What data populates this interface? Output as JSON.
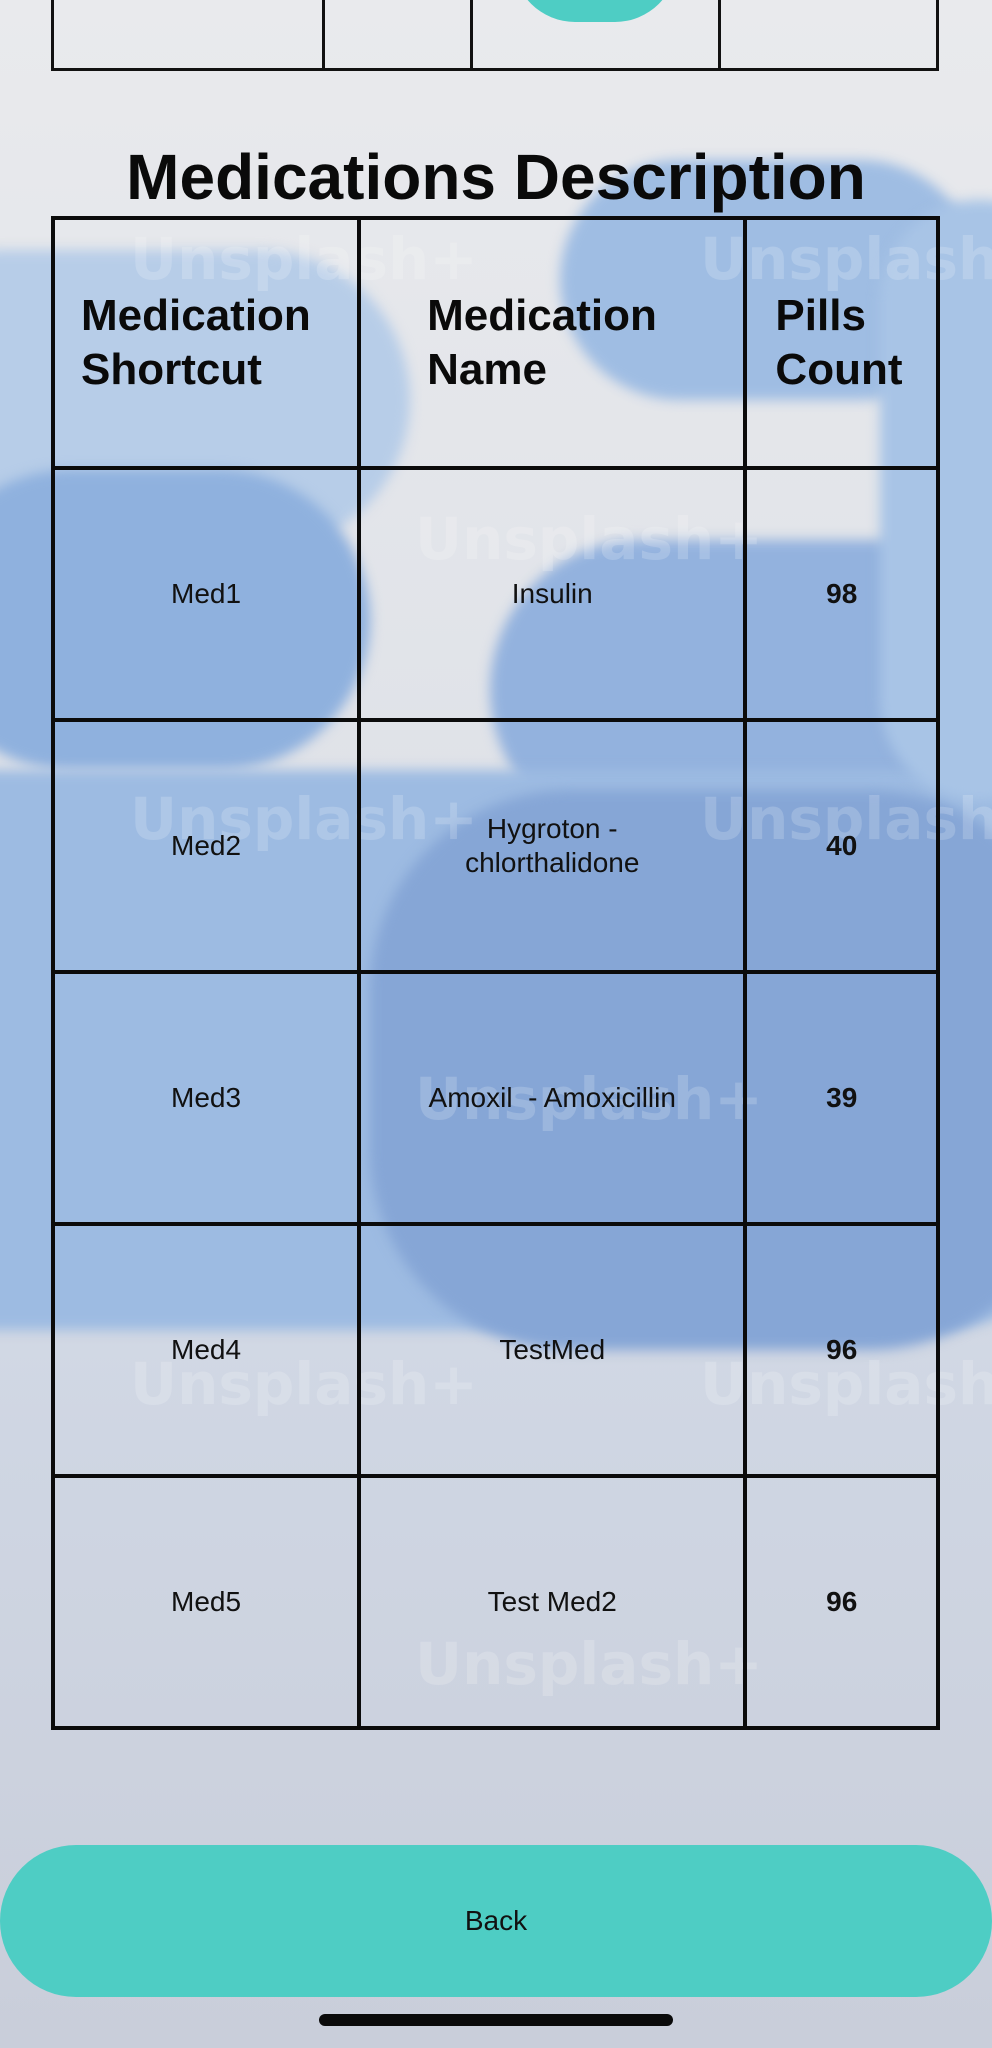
{
  "page": {
    "title": "Medications Description",
    "accent_color": "#4ECDC4",
    "count_color": "#E8161B",
    "background_image": "blue-pills-photo",
    "watermark_text": "Unsplash+"
  },
  "table": {
    "headers": {
      "shortcut": "Medication Shortcut",
      "name": "Medication Name",
      "count": "Pills Count"
    },
    "rows": [
      {
        "shortcut": "Med1",
        "name": "Insulin",
        "count": "98"
      },
      {
        "shortcut": "Med2",
        "name": "Hygroton - chlorthalidone",
        "count": "40"
      },
      {
        "shortcut": "Med3",
        "name": "Amoxil  - Amoxicillin",
        "count": "39"
      },
      {
        "shortcut": "Med4",
        "name": "TestMed",
        "count": "96"
      },
      {
        "shortcut": "Med5",
        "name": "Test Med2",
        "count": "96"
      }
    ]
  },
  "footer": {
    "back_label": "Back"
  }
}
